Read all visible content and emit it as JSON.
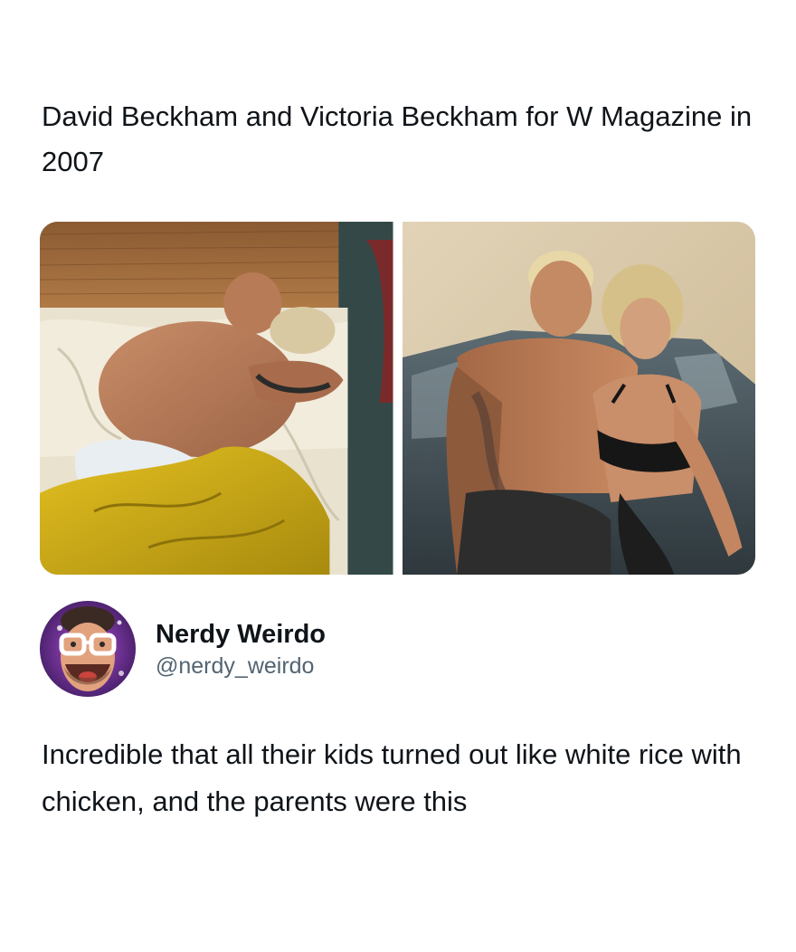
{
  "quoted_post": {
    "text": "David Beckham and Victoria Beckham for W Magazine in 2007"
  },
  "media": {
    "photos": [
      {
        "name": "photo-bed"
      },
      {
        "name": "photo-car"
      }
    ]
  },
  "author": {
    "display_name": "Nerdy Weirdo",
    "handle": "@nerdy_weirdo"
  },
  "reply": {
    "text": "Incredible that all their kids turned out like white rice with chicken, and the parents were this"
  },
  "colors": {
    "text_primary": "#0f1419",
    "text_secondary": "#536471",
    "background": "#ffffff"
  }
}
